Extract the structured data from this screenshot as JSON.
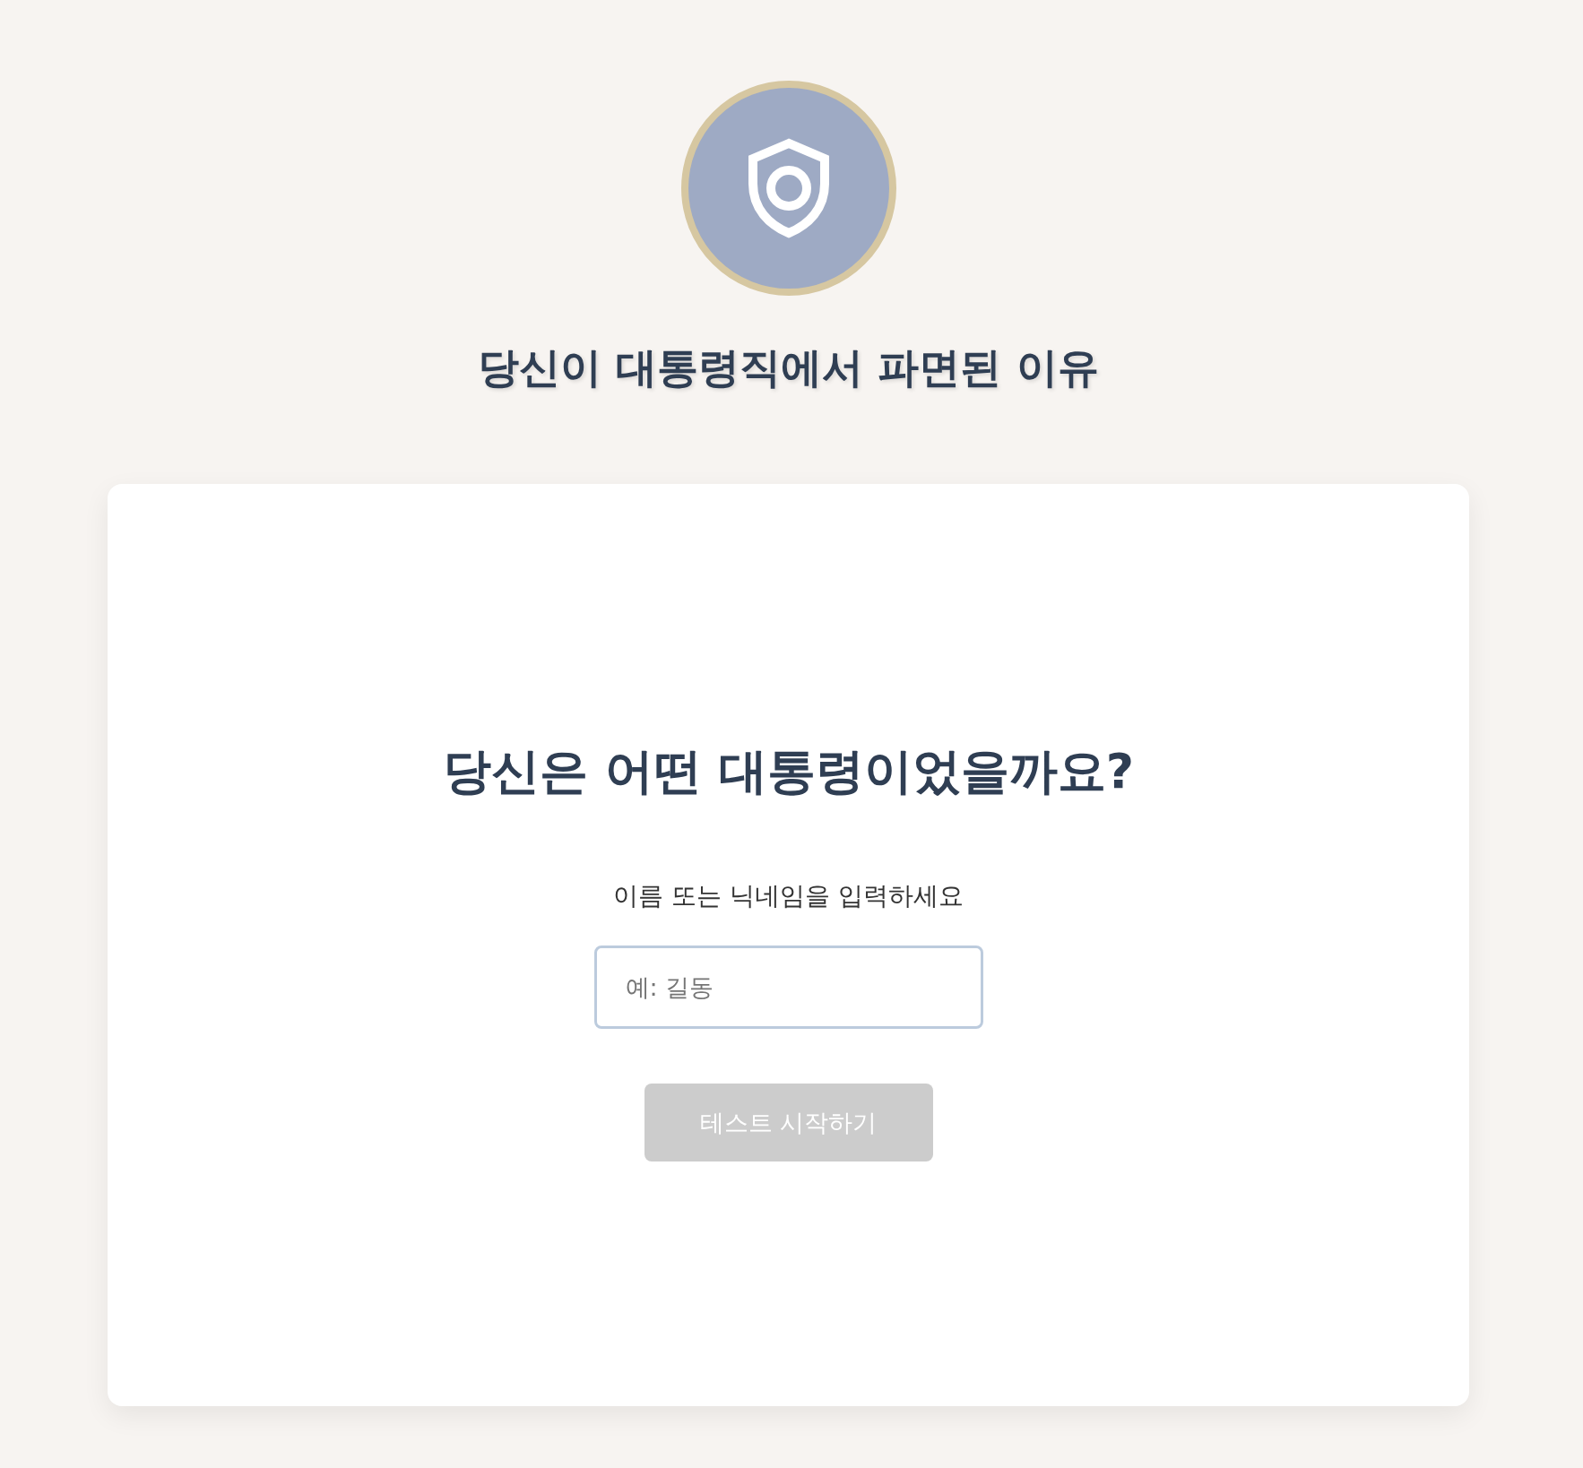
{
  "header": {
    "title": "당신이 대통령직에서 파면된 이유"
  },
  "card": {
    "question": "당신은 어떤 대통령이었을까요?",
    "name_label": "이름 또는 닉네임을 입력하세요",
    "name_input": {
      "placeholder": "예: 길동"
    },
    "start_button": {
      "label": "테스트 시작하기",
      "disabled": true
    }
  }
}
